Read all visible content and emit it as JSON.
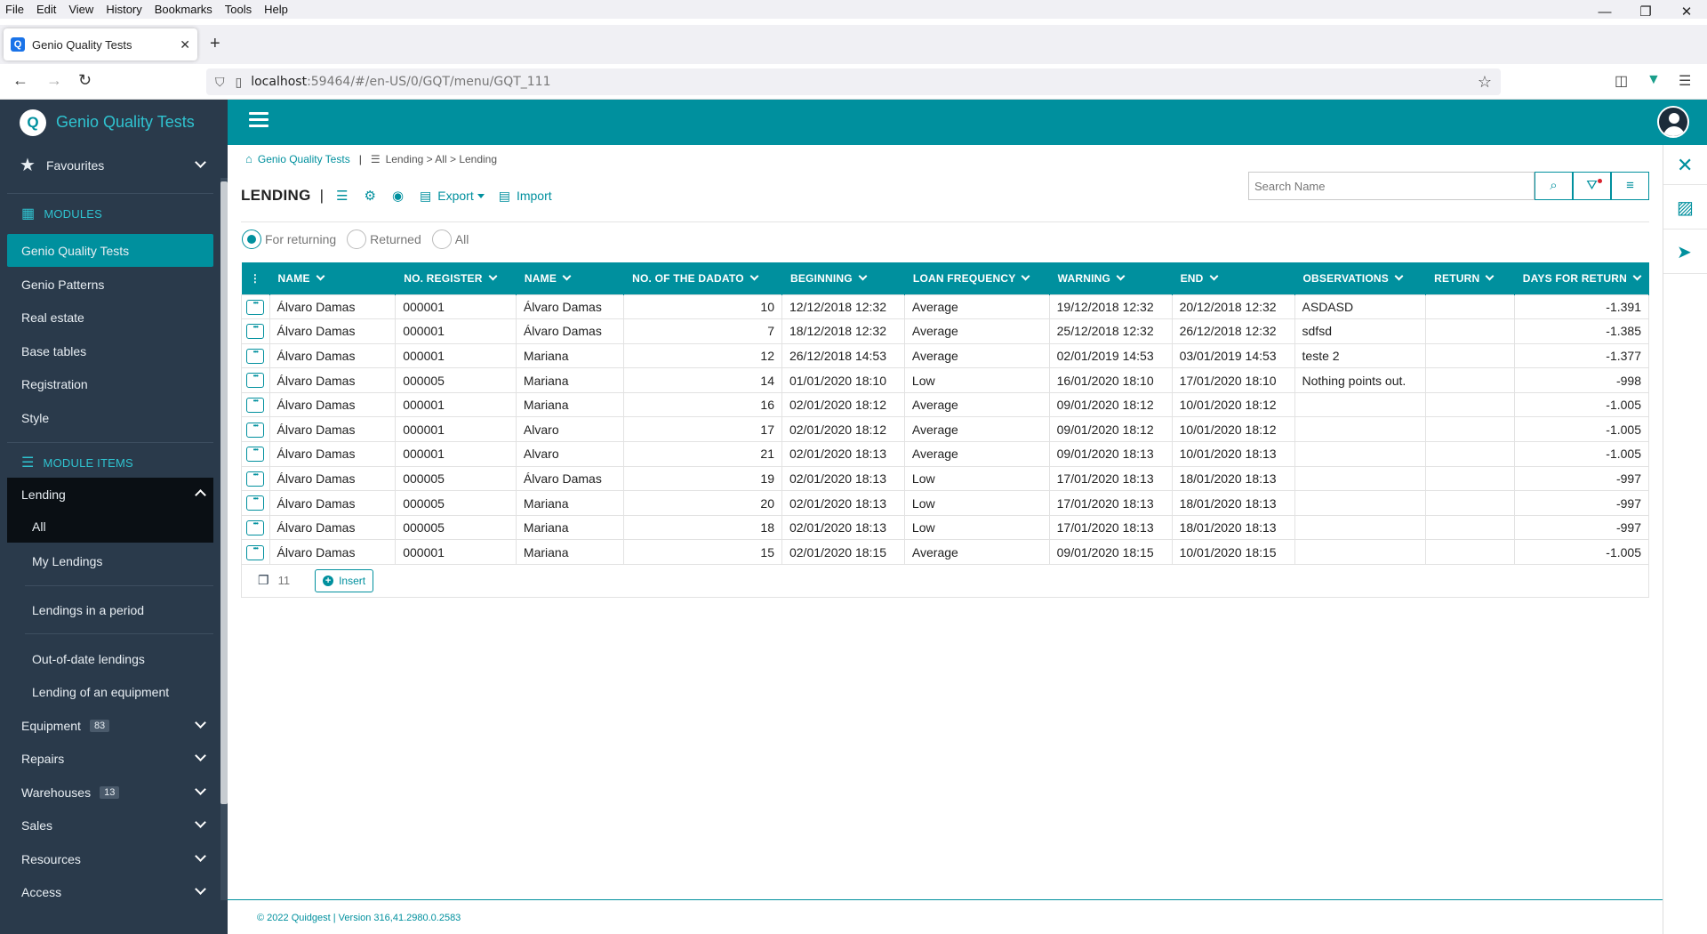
{
  "browser": {
    "menu": [
      "File",
      "Edit",
      "View",
      "History",
      "Bookmarks",
      "Tools",
      "Help"
    ],
    "tab_title": "Genio Quality Tests",
    "url_host": "localhost",
    "url_rest": ":59464/#/en-US/0/GQT/menu/GQT_111"
  },
  "app": {
    "brand": "Genio Quality Tests"
  },
  "sidebar": {
    "favourites": "Favourites",
    "modules_header": "MODULES",
    "modules": [
      "Genio Quality Tests",
      "Genio Patterns",
      "Real estate",
      "Base tables",
      "Registration",
      "Style"
    ],
    "module_items_header": "MODULE ITEMS",
    "lending": "Lending",
    "lending_items": [
      "All",
      "My Lendings",
      "Lendings in a period",
      "Out-of-date lendings",
      "Lending of an equipment"
    ],
    "groups": [
      {
        "label": "Equipment",
        "badge": "83"
      },
      {
        "label": "Repairs",
        "badge": ""
      },
      {
        "label": "Warehouses",
        "badge": "13"
      },
      {
        "label": "Sales",
        "badge": ""
      },
      {
        "label": "Resources",
        "badge": ""
      },
      {
        "label": "Access",
        "badge": ""
      }
    ]
  },
  "breadcrumb": {
    "home": "Genio Quality Tests",
    "path": "Lending > All > Lending"
  },
  "page": {
    "title": "LENDING",
    "export": "Export",
    "import": "Import",
    "search_placeholder": "Search Name"
  },
  "filters": {
    "options": [
      "For returning",
      "Returned",
      "All"
    ],
    "selected": "For returning"
  },
  "table": {
    "columns": [
      "NAME",
      "NO. REGISTER",
      "NAME",
      "NO. OF THE DADATO",
      "BEGINNING",
      "LOAN FREQUENCY",
      "WARNING",
      "END",
      "OBSERVATIONS",
      "RETURN",
      "DAYS FOR RETURN"
    ],
    "rows": [
      [
        "Álvaro Damas",
        "000001",
        "Álvaro Damas",
        "10",
        "12/12/2018 12:32",
        "Average",
        "19/12/2018 12:32",
        "20/12/2018 12:32",
        "ASDASD",
        "",
        "-1.391"
      ],
      [
        "Álvaro Damas",
        "000001",
        "Álvaro Damas",
        "7",
        "18/12/2018 12:32",
        "Average",
        "25/12/2018 12:32",
        "26/12/2018 12:32",
        "sdfsd",
        "",
        "-1.385"
      ],
      [
        "Álvaro Damas",
        "000001",
        "Mariana",
        "12",
        "26/12/2018 14:53",
        "Average",
        "02/01/2019 14:53",
        "03/01/2019 14:53",
        "teste 2",
        "",
        "-1.377"
      ],
      [
        "Álvaro Damas",
        "000005",
        "Mariana",
        "14",
        "01/01/2020 18:10",
        "Low",
        "16/01/2020 18:10",
        "17/01/2020 18:10",
        "Nothing points out.",
        "",
        "-998"
      ],
      [
        "Álvaro Damas",
        "000001",
        "Mariana",
        "16",
        "02/01/2020 18:12",
        "Average",
        "09/01/2020 18:12",
        "10/01/2020 18:12",
        "",
        "",
        "-1.005"
      ],
      [
        "Álvaro Damas",
        "000001",
        "Alvaro",
        "17",
        "02/01/2020 18:12",
        "Average",
        "09/01/2020 18:12",
        "10/01/2020 18:12",
        "",
        "",
        "-1.005"
      ],
      [
        "Álvaro Damas",
        "000001",
        "Alvaro",
        "21",
        "02/01/2020 18:13",
        "Average",
        "09/01/2020 18:13",
        "10/01/2020 18:13",
        "",
        "",
        "-1.005"
      ],
      [
        "Álvaro Damas",
        "000005",
        "Álvaro Damas",
        "19",
        "02/01/2020 18:13",
        "Low",
        "17/01/2020 18:13",
        "18/01/2020 18:13",
        "",
        "",
        "-997"
      ],
      [
        "Álvaro Damas",
        "000005",
        "Mariana",
        "20",
        "02/01/2020 18:13",
        "Low",
        "17/01/2020 18:13",
        "18/01/2020 18:13",
        "",
        "",
        "-997"
      ],
      [
        "Álvaro Damas",
        "000005",
        "Mariana",
        "18",
        "02/01/2020 18:13",
        "Low",
        "17/01/2020 18:13",
        "18/01/2020 18:13",
        "",
        "",
        "-997"
      ],
      [
        "Álvaro Damas",
        "000001",
        "Mariana",
        "15",
        "02/01/2020 18:15",
        "Average",
        "09/01/2020 18:15",
        "10/01/2020 18:15",
        "",
        "",
        "-1.005"
      ]
    ],
    "count": "11",
    "insert": "Insert"
  },
  "footer": {
    "text": "© 2022 Quidgest | Version 316,41.2980.0.2583"
  },
  "colors": {
    "accent": "#00909e",
    "sidebar": "#2a3a4b",
    "brand_text": "#2fc3d0"
  }
}
